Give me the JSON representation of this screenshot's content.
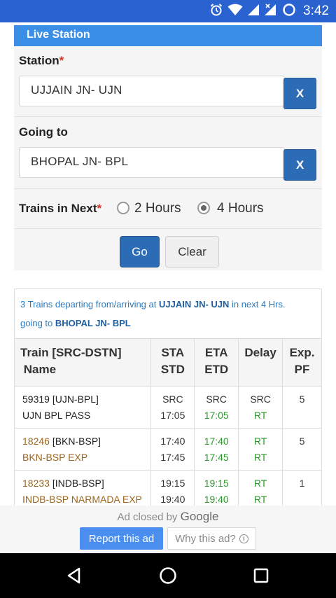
{
  "status_bar": {
    "time": "3:42",
    "icons": [
      "alarm-icon",
      "wifi-icon",
      "signal-icon",
      "signal-no-data-icon",
      "battery-icon"
    ]
  },
  "panel": {
    "title": "Live Station",
    "station_label": "Station",
    "required_mark": "*",
    "station_value": "UJJAIN JN- UJN",
    "clear_x": "X",
    "going_to_label": "Going to",
    "going_to_value": "BHOPAL  JN- BPL",
    "trains_next_label": "Trains in Next",
    "option_2h": "2 Hours",
    "option_4h": "4 Hours",
    "selected": "4 Hours",
    "go_button": "Go",
    "clear_button": "Clear"
  },
  "results": {
    "summary_prefix": "3 Trains departing from/arriving at",
    "summary_station": "UJJAIN JN- UJN",
    "summary_mid": "in next 4 Hrs.",
    "summary_going": "going to",
    "summary_dest": "BHOPAL JN- BPL",
    "headers": {
      "train_line1": "Train [SRC-DSTN]",
      "train_line2": "Name",
      "sta": "STA",
      "std": "STD",
      "eta": "ETA",
      "etd": "ETD",
      "delay": "Delay",
      "exp": "Exp.",
      "pf": "PF"
    },
    "rows": [
      {
        "train_no": "59319 [UJN-BPL]",
        "name": "UJN BPL PASS",
        "sta": "SRC",
        "std": "17:05",
        "eta": "SRC",
        "etd": "17:05",
        "delay1": "SRC",
        "delay2": "RT",
        "pf": "5"
      },
      {
        "train_no": "18246",
        "route": " [BKN-BSP]",
        "name": "BKN-BSP EXP",
        "sta": "17:40",
        "std": "17:45",
        "eta": "17:40",
        "etd": "17:45",
        "delay1": "RT",
        "delay2": "RT",
        "pf": "5"
      },
      {
        "train_no": "18233",
        "route": " [INDB-BSP]",
        "name": "INDB-BSP NARMADA EXP",
        "sta": "19:15",
        "std": "19:40",
        "eta": "19:15",
        "etd": "19:40",
        "delay1": "RT",
        "delay2": "RT",
        "pf": "1"
      }
    ]
  },
  "ad": {
    "closed_text": "Ad closed by",
    "google": "Google",
    "report_button": "Report this ad",
    "why_button": "Why this ad?",
    "info_glyph": "i"
  },
  "colors": {
    "status_bar": "#2a62d0",
    "header": "#3a8ee6",
    "button": "#2c6bb5",
    "green": "#2b9a2b",
    "brown": "#a0661d"
  }
}
